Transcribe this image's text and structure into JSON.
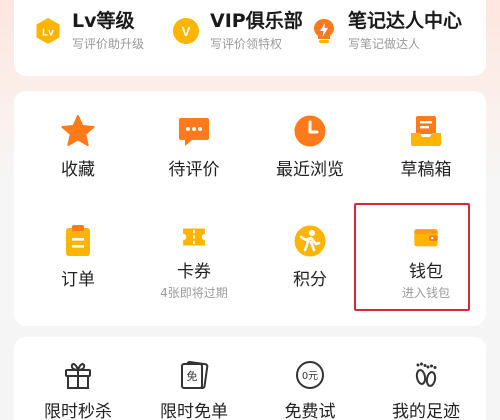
{
  "colors": {
    "accent_orange": "#ff7a1a",
    "accent_yellow": "#ffb400",
    "highlight_red": "#d6283a"
  },
  "membership": [
    {
      "icon": "lv-badge-icon",
      "title": "Lv等级",
      "subtitle": "写评价助升级"
    },
    {
      "icon": "vip-badge-icon",
      "title": "VIP俱乐部",
      "subtitle": "写评价领特权"
    },
    {
      "icon": "lightbulb-badge-icon",
      "title": "笔记达人中心",
      "subtitle": "写笔记做达人"
    }
  ],
  "badges": {
    "lv": "Lv",
    "vip": "V"
  },
  "grid": [
    {
      "icon": "star-icon",
      "label": "收藏"
    },
    {
      "icon": "comment-icon",
      "label": "待评价"
    },
    {
      "icon": "clock-icon",
      "label": "最近浏览"
    },
    {
      "icon": "draft-box-icon",
      "label": "草稿箱"
    },
    {
      "icon": "order-icon",
      "label": "订单"
    },
    {
      "icon": "ticket-icon",
      "label": "卡券",
      "sub": "4张即将过期"
    },
    {
      "icon": "points-icon",
      "label": "积分"
    },
    {
      "icon": "wallet-icon",
      "label": "钱包",
      "sub": "进入钱包"
    }
  ],
  "tools": [
    {
      "icon": "gift-icon",
      "label": "限时秒杀"
    },
    {
      "icon": "free-ticket-icon",
      "label": "限时免单",
      "glyph": "免"
    },
    {
      "icon": "free-trial-icon",
      "label": "免费试",
      "glyph": "0元"
    },
    {
      "icon": "footprints-icon",
      "label": "我的足迹"
    }
  ]
}
